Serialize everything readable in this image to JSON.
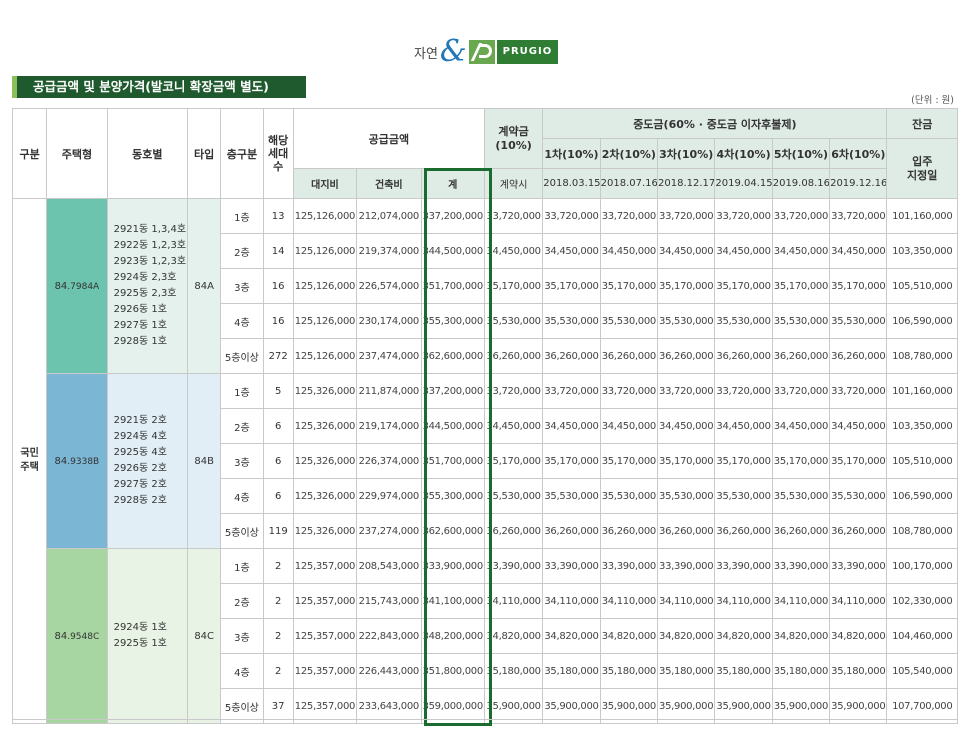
{
  "logo": {
    "jayeon": "자연",
    "amp": "&",
    "brand": "PRUGIO"
  },
  "title": "공급금액 및 분양가격(발코니 확장금액 별도)",
  "unit": "(단위 : 원)",
  "headers": {
    "gubun": "구분",
    "housing_type": "주택형",
    "dong_ho": "동호별",
    "tipe": "타입",
    "floor": "층구분",
    "households": "해당\n세대\n수",
    "supply": "공급금액",
    "land": "대지비",
    "building": "건축비",
    "total": "계",
    "contract": "계약금\n(10%)",
    "contract_when": "계약시",
    "middle": "중도금(60% · 중도금 이자후불제)",
    "mid": [
      {
        "label": "1차(10%)",
        "date": "2018.03.15"
      },
      {
        "label": "2차(10%)",
        "date": "2018.07.16"
      },
      {
        "label": "3차(10%)",
        "date": "2018.12.17"
      },
      {
        "label": "4차(10%)",
        "date": "2019.04.15"
      },
      {
        "label": "5차(10%)",
        "date": "2019.08.16"
      },
      {
        "label": "6차(10%)",
        "date": "2019.12.16"
      }
    ],
    "balance": "잔금",
    "balance_when": "입주\n지정일"
  },
  "gubun_value": "국민\n주택",
  "groups": [
    {
      "type_main": "84",
      "type_small": ".7984A",
      "dong": "2921동 1,3,4호\n2922동 1,2,3호\n2923동 1,2,3호\n2924동 2,3호\n2925동 2,3호\n2926동 1호\n2927동 1호\n2928동 1호",
      "tipe": "84A",
      "rows": [
        {
          "floor": "1층",
          "cnt": "13",
          "land": "125,126,000",
          "bld": "212,074,000",
          "total": "337,200,000",
          "contract": "33,720,000",
          "mid": "33,720,000",
          "bal": "101,160,000"
        },
        {
          "floor": "2층",
          "cnt": "14",
          "land": "125,126,000",
          "bld": "219,374,000",
          "total": "344,500,000",
          "contract": "34,450,000",
          "mid": "34,450,000",
          "bal": "103,350,000"
        },
        {
          "floor": "3층",
          "cnt": "16",
          "land": "125,126,000",
          "bld": "226,574,000",
          "total": "351,700,000",
          "contract": "35,170,000",
          "mid": "35,170,000",
          "bal": "105,510,000"
        },
        {
          "floor": "4층",
          "cnt": "16",
          "land": "125,126,000",
          "bld": "230,174,000",
          "total": "355,300,000",
          "contract": "35,530,000",
          "mid": "35,530,000",
          "bal": "106,590,000"
        },
        {
          "floor": "5층이상",
          "cnt": "272",
          "land": "125,126,000",
          "bld": "237,474,000",
          "total": "362,600,000",
          "contract": "36,260,000",
          "mid": "36,260,000",
          "bal": "108,780,000"
        }
      ]
    },
    {
      "type_main": "84",
      "type_small": ".9338B",
      "dong": "2921동 2호\n2924동 4호\n2925동 4호\n2926동 2호\n2927동 2호\n2928동 2호",
      "tipe": "84B",
      "rows": [
        {
          "floor": "1층",
          "cnt": "5",
          "land": "125,326,000",
          "bld": "211,874,000",
          "total": "337,200,000",
          "contract": "33,720,000",
          "mid": "33,720,000",
          "bal": "101,160,000"
        },
        {
          "floor": "2층",
          "cnt": "6",
          "land": "125,326,000",
          "bld": "219,174,000",
          "total": "344,500,000",
          "contract": "34,450,000",
          "mid": "34,450,000",
          "bal": "103,350,000"
        },
        {
          "floor": "3층",
          "cnt": "6",
          "land": "125,326,000",
          "bld": "226,374,000",
          "total": "351,700,000",
          "contract": "35,170,000",
          "mid": "35,170,000",
          "bal": "105,510,000"
        },
        {
          "floor": "4층",
          "cnt": "6",
          "land": "125,326,000",
          "bld": "229,974,000",
          "total": "355,300,000",
          "contract": "35,530,000",
          "mid": "35,530,000",
          "bal": "106,590,000"
        },
        {
          "floor": "5층이상",
          "cnt": "119",
          "land": "125,326,000",
          "bld": "237,274,000",
          "total": "362,600,000",
          "contract": "36,260,000",
          "mid": "36,260,000",
          "bal": "108,780,000"
        }
      ]
    },
    {
      "type_main": "84",
      "type_small": ".9548C",
      "dong": "2924동 1호\n2925동 1호",
      "tipe": "84C",
      "rows": [
        {
          "floor": "1층",
          "cnt": "2",
          "land": "125,357,000",
          "bld": "208,543,000",
          "total": "333,900,000",
          "contract": "33,390,000",
          "mid": "33,390,000",
          "bal": "100,170,000"
        },
        {
          "floor": "2층",
          "cnt": "2",
          "land": "125,357,000",
          "bld": "215,743,000",
          "total": "341,100,000",
          "contract": "34,110,000",
          "mid": "34,110,000",
          "bal": "102,330,000"
        },
        {
          "floor": "3층",
          "cnt": "2",
          "land": "125,357,000",
          "bld": "222,843,000",
          "total": "348,200,000",
          "contract": "34,820,000",
          "mid": "34,820,000",
          "bal": "104,460,000"
        },
        {
          "floor": "4층",
          "cnt": "2",
          "land": "125,357,000",
          "bld": "226,443,000",
          "total": "351,800,000",
          "contract": "35,180,000",
          "mid": "35,180,000",
          "bal": "105,540,000"
        },
        {
          "floor": "5층이상",
          "cnt": "37",
          "land": "125,357,000",
          "bld": "233,643,000",
          "total": "359,000,000",
          "contract": "35,900,000",
          "mid": "35,900,000",
          "bal": "107,700,000"
        }
      ]
    }
  ]
}
